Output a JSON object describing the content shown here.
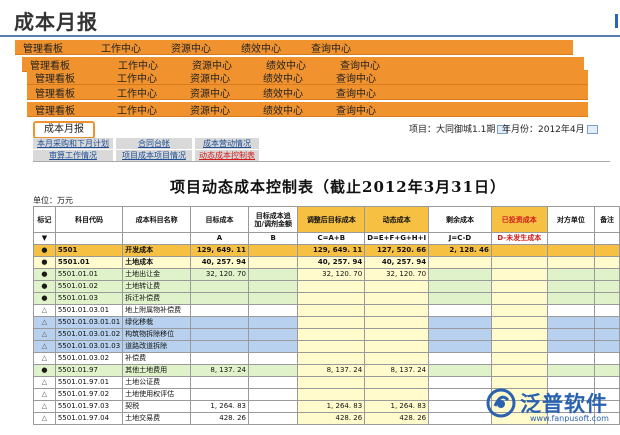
{
  "page": {
    "title": "成本月报"
  },
  "navbars": [
    {
      "items": [
        "管理看板",
        "工作中心",
        "资源中心",
        "绩效中心",
        "查询中心"
      ]
    },
    {
      "items": [
        "管理看板",
        "工作中心",
        "资源中心",
        "绩效中心",
        "查询中心"
      ]
    },
    {
      "items": [
        "管理看板",
        "工作中心",
        "资源中心",
        "绩效中心",
        "查询中心"
      ]
    },
    {
      "items": [
        "管理看板",
        "工作中心",
        "资源中心",
        "绩效中心",
        "查询中心"
      ]
    },
    {
      "items": [
        "管理看板",
        "工作中心",
        "资源中心",
        "绩效中心",
        "查询中心"
      ]
    }
  ],
  "toolbar": {
    "report_button": "成本月报",
    "project_label": "项目：大同御城1.1期",
    "month_label": "年月份：2012年4月"
  },
  "tabs": {
    "row1": [
      "本月采购和下月计划",
      "合同台帐",
      "成本营动情况"
    ],
    "row2": [
      "审算工作情况",
      "项目成本项目情况",
      "动态成本控制表"
    ]
  },
  "report": {
    "title": "项目动态成本控制表（截止2012年3月31日）",
    "unit": "单位：万元",
    "columns": [
      "标记",
      "科目代码",
      "成本科目名称",
      "目标成本",
      "目标成本追加/调剂金额",
      "调整后目标成本",
      "动态成本",
      "剩余成本",
      "已投资成本",
      "对方单位",
      "备注"
    ],
    "formula_row": [
      "▼",
      "",
      "",
      "A",
      "B",
      "C=A+B",
      "D=E+F+G+H+I",
      "J=C-D",
      "D-未发生成本",
      "",
      ""
    ],
    "rows": [
      {
        "mark": "●",
        "code": "5501",
        "name": "开发成本",
        "target": "129, 649. 11",
        "adjust": "",
        "adjusted": "129, 649. 11",
        "dynamic": "127, 520. 66",
        "remain": "2, 128. 46",
        "style": "orange"
      },
      {
        "mark": "●",
        "code": "5501.01",
        "name": "土地成本",
        "target": "40, 257. 94",
        "adjust": "",
        "adjusted": "40, 257. 94",
        "dynamic": "40, 257. 94",
        "remain": "",
        "style": "yellow"
      },
      {
        "mark": "●",
        "code": "5501.01.01",
        "name": "土地出让金",
        "target": "32, 120. 70",
        "adjust": "",
        "adjusted": "32, 120. 70",
        "dynamic": "32, 120. 70",
        "remain": "",
        "style": "green"
      },
      {
        "mark": "●",
        "code": "5501.01.02",
        "name": "土地转让费",
        "target": "",
        "adjust": "",
        "adjusted": "",
        "dynamic": "",
        "remain": "",
        "style": "green"
      },
      {
        "mark": "●",
        "code": "5501.01.03",
        "name": "拆迁补偿费",
        "target": "",
        "adjust": "",
        "adjusted": "",
        "dynamic": "",
        "remain": "",
        "style": "green"
      },
      {
        "mark": "△",
        "code": "5501.01.03.01",
        "name": "地上附属物补偿费",
        "target": "",
        "adjust": "",
        "adjusted": "",
        "dynamic": "",
        "remain": "",
        "style": "white"
      },
      {
        "mark": "△",
        "code": "5501.01.03.01.01",
        "name": "绿化移栽",
        "target": "",
        "adjust": "",
        "adjusted": "",
        "dynamic": "",
        "remain": "",
        "style": "blue"
      },
      {
        "mark": "△",
        "code": "5501.01.03.01.02",
        "name": "构筑物拆除移位",
        "target": "",
        "adjust": "",
        "adjusted": "",
        "dynamic": "",
        "remain": "",
        "style": "blue"
      },
      {
        "mark": "△",
        "code": "5501.01.03.01.03",
        "name": "道路改道拆除",
        "target": "",
        "adjust": "",
        "adjusted": "",
        "dynamic": "",
        "remain": "",
        "style": "blue"
      },
      {
        "mark": "△",
        "code": "5501.01.03.02",
        "name": "补偿费",
        "target": "",
        "adjust": "",
        "adjusted": "",
        "dynamic": "",
        "remain": "",
        "style": "white"
      },
      {
        "mark": "●",
        "code": "5501.01.97",
        "name": "其他土地费用",
        "target": "8, 137. 24",
        "adjust": "",
        "adjusted": "8, 137. 24",
        "dynamic": "8, 137. 24",
        "remain": "",
        "style": "green"
      },
      {
        "mark": "△",
        "code": "5501.01.97.01",
        "name": "土地公证费",
        "target": "",
        "adjust": "",
        "adjusted": "",
        "dynamic": "",
        "remain": "",
        "style": "white"
      },
      {
        "mark": "△",
        "code": "5501.01.97.02",
        "name": "土地使用权评估",
        "target": "",
        "adjust": "",
        "adjusted": "",
        "dynamic": "",
        "remain": "",
        "style": "white"
      },
      {
        "mark": "△",
        "code": "5501.01.97.03",
        "name": "契税",
        "target": "1, 264. 83",
        "adjust": "",
        "adjusted": "1, 264. 83",
        "dynamic": "1, 264. 83",
        "remain": "",
        "style": "white"
      },
      {
        "mark": "△",
        "code": "5501.01.97.04",
        "name": "土地交易费",
        "target": "428. 26",
        "adjust": "",
        "adjusted": "428. 26",
        "dynamic": "428. 26",
        "remain": "",
        "style": "white"
      }
    ]
  },
  "watermark": {
    "brand": "泛普软件",
    "url": "www.fanpusoft.com"
  }
}
